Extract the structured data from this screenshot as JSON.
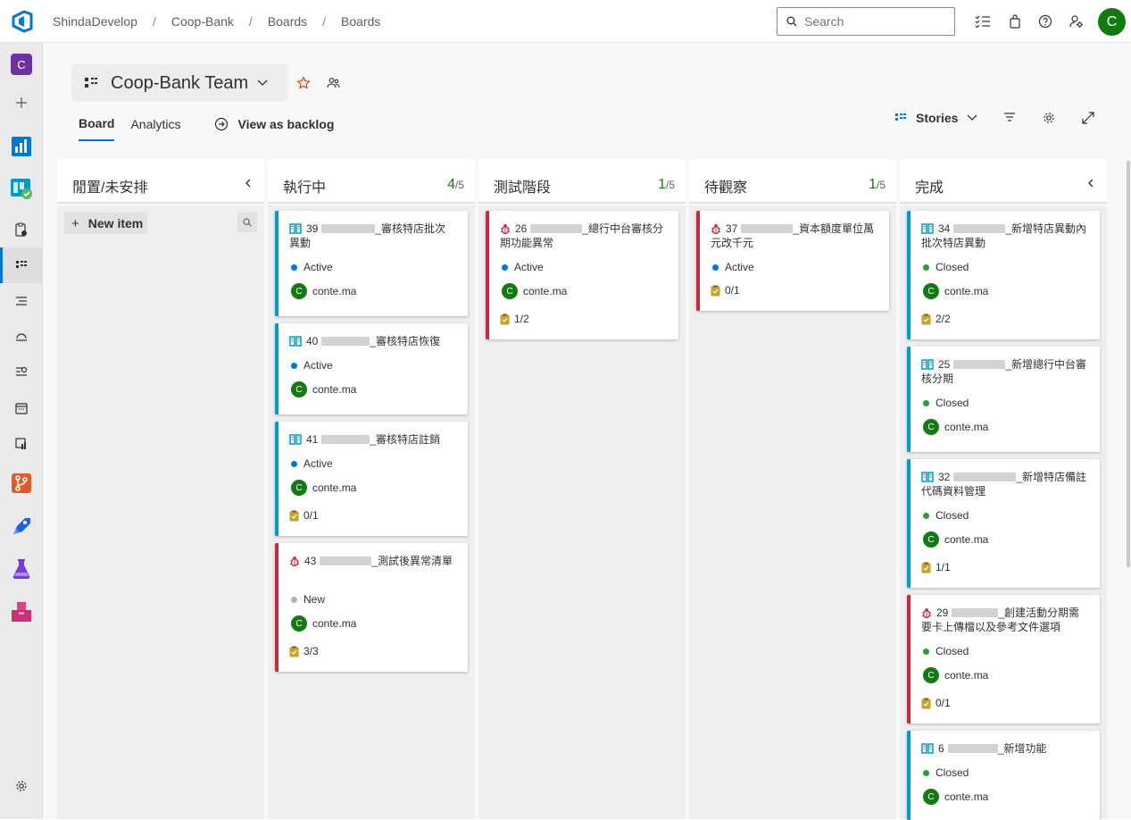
{
  "breadcrumb": [
    "ShindaDevelop",
    "Coop-Bank",
    "Boards",
    "Boards"
  ],
  "search": {
    "placeholder": "Search"
  },
  "user": {
    "initial": "C"
  },
  "project": {
    "initial": "C"
  },
  "team": {
    "name": "Coop-Bank Team"
  },
  "tabs": [
    {
      "label": "Board"
    },
    {
      "label": "Analytics"
    }
  ],
  "view_as_backlog": "View as backlog",
  "backlog_level": "Stories",
  "new_item": "New item",
  "columns": [
    {
      "title": "閒置/未安排",
      "count": "",
      "limit": ""
    },
    {
      "title": "執行中",
      "count": "4",
      "limit": "/5"
    },
    {
      "title": "測試階段",
      "count": "1",
      "limit": "/5"
    },
    {
      "title": "待觀察",
      "count": "1",
      "limit": "/5"
    },
    {
      "title": "完成",
      "count": "",
      "limit": ""
    }
  ],
  "cards": {
    "c39": {
      "type": "story",
      "id": "39",
      "title": "_審核特店批次異動",
      "state": "Active",
      "assignee": "conte.ma",
      "avatar": "C",
      "tasks": ""
    },
    "c40": {
      "type": "story",
      "id": "40",
      "title": "_審核特店恢復",
      "state": "Active",
      "assignee": "conte.ma",
      "avatar": "C",
      "tasks": ""
    },
    "c41": {
      "type": "story",
      "id": "41",
      "title": "_審核特店註銷",
      "state": "Active",
      "assignee": "conte.ma",
      "avatar": "C",
      "tasks": "0/1"
    },
    "c43": {
      "type": "bug",
      "id": "43",
      "title": "_測試後異常清單",
      "state": "New",
      "assignee": "conte.ma",
      "avatar": "C",
      "tasks": "3/3"
    },
    "c26": {
      "type": "bug",
      "id": "26",
      "title": "_總行中台審核分期功能異常",
      "state": "Active",
      "assignee": "conte.ma",
      "avatar": "C",
      "tasks": "1/2"
    },
    "c37": {
      "type": "bug",
      "id": "37",
      "title": "_資本額度單位萬元改千元",
      "state": "Active",
      "assignee": "",
      "avatar": "",
      "tasks": "0/1"
    },
    "c34": {
      "type": "story",
      "id": "34",
      "title": "_新增特店異動內批次特店異動",
      "state": "Closed",
      "assignee": "conte.ma",
      "avatar": "C",
      "tasks": "2/2"
    },
    "c25": {
      "type": "story",
      "id": "25",
      "title": "_新增總行中台審核分期",
      "state": "Closed",
      "assignee": "conte.ma",
      "avatar": "C",
      "tasks": ""
    },
    "c32": {
      "type": "story",
      "id": "32",
      "title": "_新增特店備註代碼資料管理",
      "state": "Closed",
      "assignee": "conte.ma",
      "avatar": "C",
      "tasks": "1/1"
    },
    "c29": {
      "type": "bug",
      "id": "29",
      "title": "_創建活動分期需要卡上傳檔以及參考文件選項",
      "state": "Closed",
      "assignee": "conte.ma",
      "avatar": "C",
      "tasks": "0/1"
    },
    "c6": {
      "type": "story",
      "id": "6",
      "title": "_新增功能",
      "state": "Closed",
      "assignee": "conte.ma",
      "avatar": "C",
      "tasks": ""
    }
  },
  "colors": {
    "active": "#0078d4",
    "new": "#b2b2b2",
    "closed": "#339933",
    "story": "#009ccc",
    "bug": "#cc293d",
    "accent": "#0078d4",
    "avatar": "#107c10"
  }
}
